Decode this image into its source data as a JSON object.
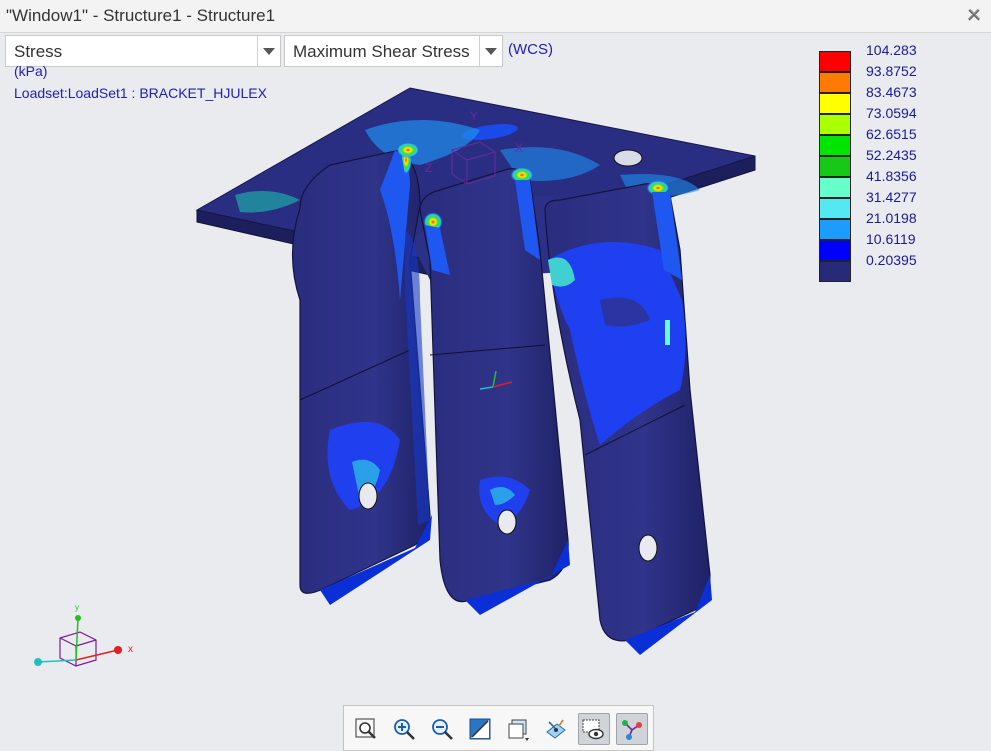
{
  "window": {
    "title": "\"Window1\" - Structure1 - Structure1"
  },
  "controls": {
    "quantity": {
      "selected": "Stress"
    },
    "component": {
      "selected": "Maximum Shear Stress"
    },
    "coordinate_system": "(WCS)"
  },
  "annotations": {
    "units": "(kPa)",
    "loadset": "Loadset:LoadSet1 :  BRACKET_HJULEX"
  },
  "legend": {
    "values": [
      "104.283",
      "93.8752",
      "83.4673",
      "73.0594",
      "62.6515",
      "52.2435",
      "41.8356",
      "31.4277",
      "21.0198",
      "10.6119",
      "0.20395"
    ],
    "colors": [
      "#ff0000",
      "#ff7a00",
      "#ffff00",
      "#aaff00",
      "#00e600",
      "#18c818",
      "#66ffcc",
      "#55e8f0",
      "#1c9cff",
      "#0000ff",
      "#272a78"
    ]
  },
  "triad": {
    "x_label": "x",
    "y_label": "y"
  },
  "toolbar": {
    "buttons": [
      {
        "name": "zoom-fit-button"
      },
      {
        "name": "zoom-in-button"
      },
      {
        "name": "zoom-out-button"
      },
      {
        "name": "repaint-button"
      },
      {
        "name": "saved-views-button"
      },
      {
        "name": "spin-center-button"
      },
      {
        "name": "display-style-button"
      },
      {
        "name": "datum-display-button"
      }
    ]
  }
}
